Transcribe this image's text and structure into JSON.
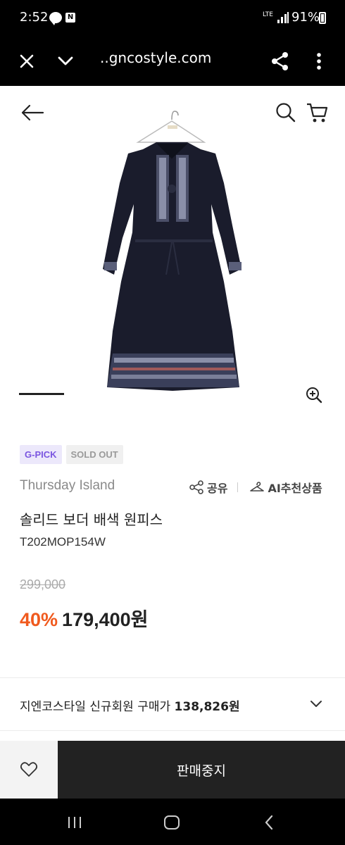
{
  "status_bar": {
    "time": "2:52",
    "notif_icons": [
      "talk-icon",
      "n-icon"
    ],
    "n_label": "N",
    "lte": "LTE",
    "battery": "91%"
  },
  "browser": {
    "url": "..gncostyle.com"
  },
  "product": {
    "badges": [
      "G-PICK",
      "SOLD OUT"
    ],
    "brand": "Thursday Island",
    "share_label": "공유",
    "ai_label": "AI추천상품",
    "name": "솔리드 보더 배색 원피스",
    "code": "T202MOP154W",
    "original_price": "299,000",
    "discount": "40%",
    "price": "179,400원"
  },
  "member_price": {
    "label": "지엔코스타일 신규회원 구매가 ",
    "value": "138,826원"
  },
  "buy_bar": {
    "status_label": "판매중지"
  },
  "colors": {
    "accent_orange": "#f05a1e",
    "gpick_purple": "#7a55e0",
    "dark": "#222222"
  }
}
